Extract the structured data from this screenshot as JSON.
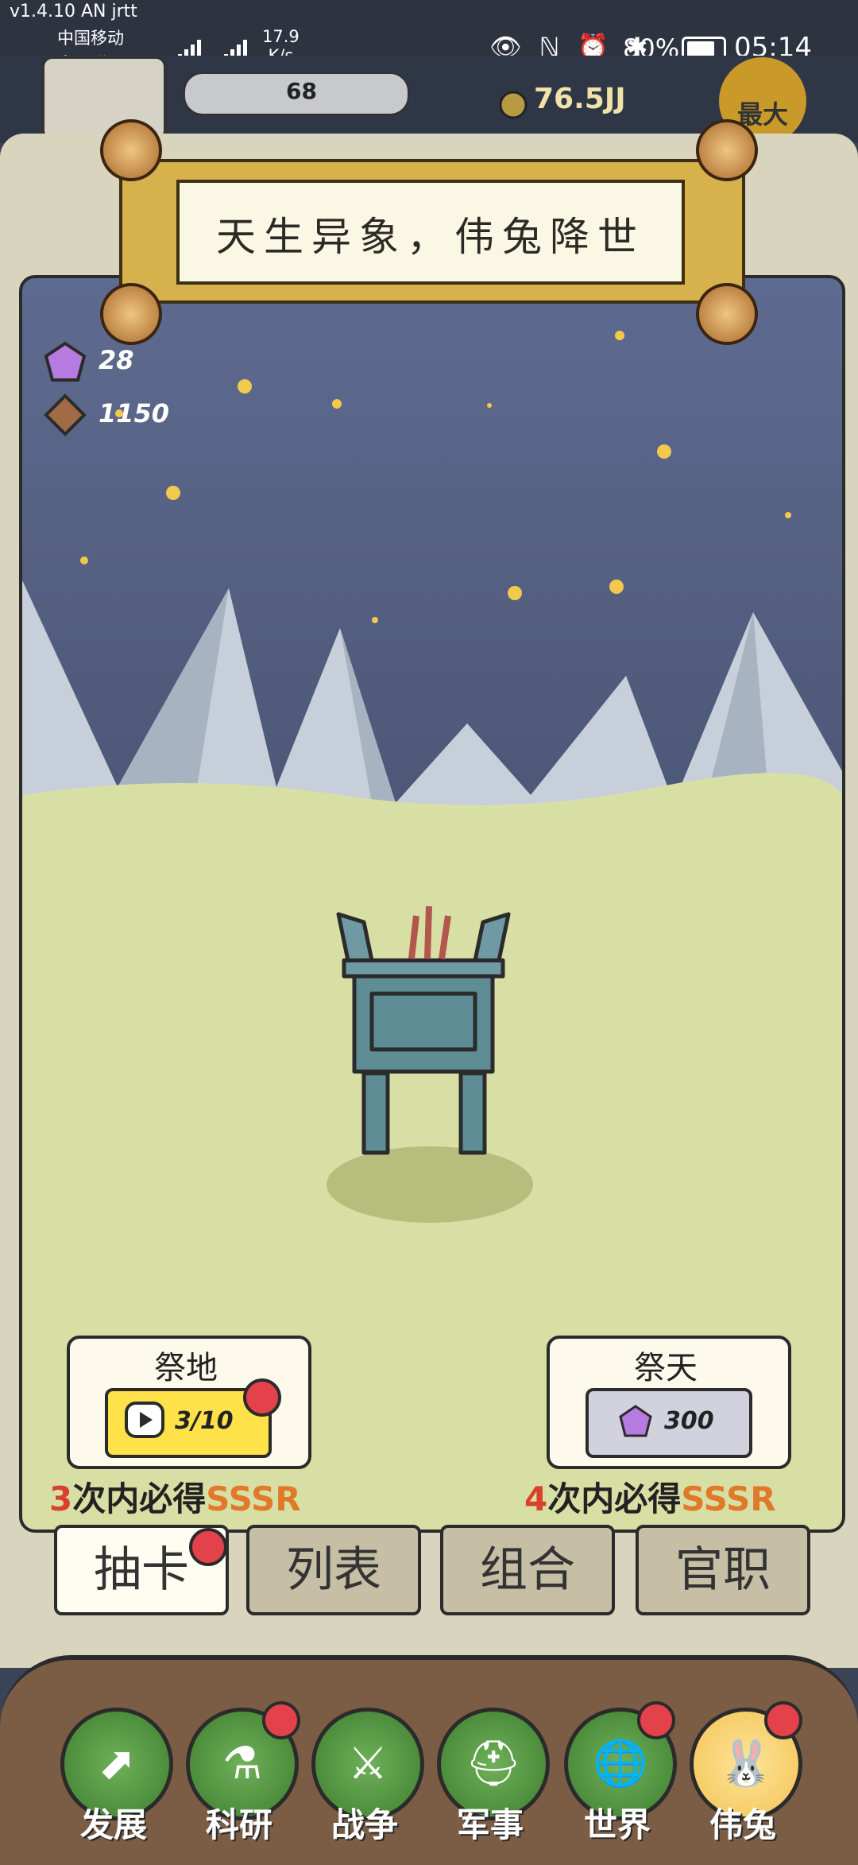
{
  "statusbar": {
    "version": "v1.4.10 AN jrtt",
    "carrier1": "中国移动",
    "carrier2": "中国联通",
    "rate_line1": "17.9",
    "rate_line2": "K/s",
    "icons": "👁 ℕ ⏰ ✱",
    "battery_text": "80%",
    "battery_level": 0.8,
    "time": "05:14"
  },
  "hud": {
    "bar_value": "68",
    "coin": "76.5JJ",
    "max_label": "最大"
  },
  "banner": {
    "title": "天生异象，伟兔降世"
  },
  "currencies": {
    "gems": "28",
    "stones": "1150"
  },
  "draw": {
    "earth": {
      "title": "祭地",
      "count": "3/10",
      "guarantee_num": "3",
      "guarantee_text": "次内必得",
      "rarity": "SSSR"
    },
    "heaven": {
      "title": "祭天",
      "cost": "300",
      "guarantee_num": "4",
      "guarantee_text": "次内必得",
      "rarity": "SSSR"
    }
  },
  "tabs": [
    "抽卡",
    "列表",
    "组合",
    "官职"
  ],
  "nav": [
    {
      "label": "发展",
      "icon": "up-arrow-icon"
    },
    {
      "label": "科研",
      "icon": "flask-icon"
    },
    {
      "label": "战争",
      "icon": "crossed-swords-icon"
    },
    {
      "label": "军事",
      "icon": "helmet-icon"
    },
    {
      "label": "世界",
      "icon": "globe-icon"
    },
    {
      "label": "伟兔",
      "icon": "rabbit-portrait-icon"
    }
  ],
  "colors": {
    "sky": "#5e6b90",
    "meadow": "#d8dfa4",
    "mountain": "#c7d0da",
    "badge": "#e3424b",
    "ding": "#5f8d96"
  }
}
